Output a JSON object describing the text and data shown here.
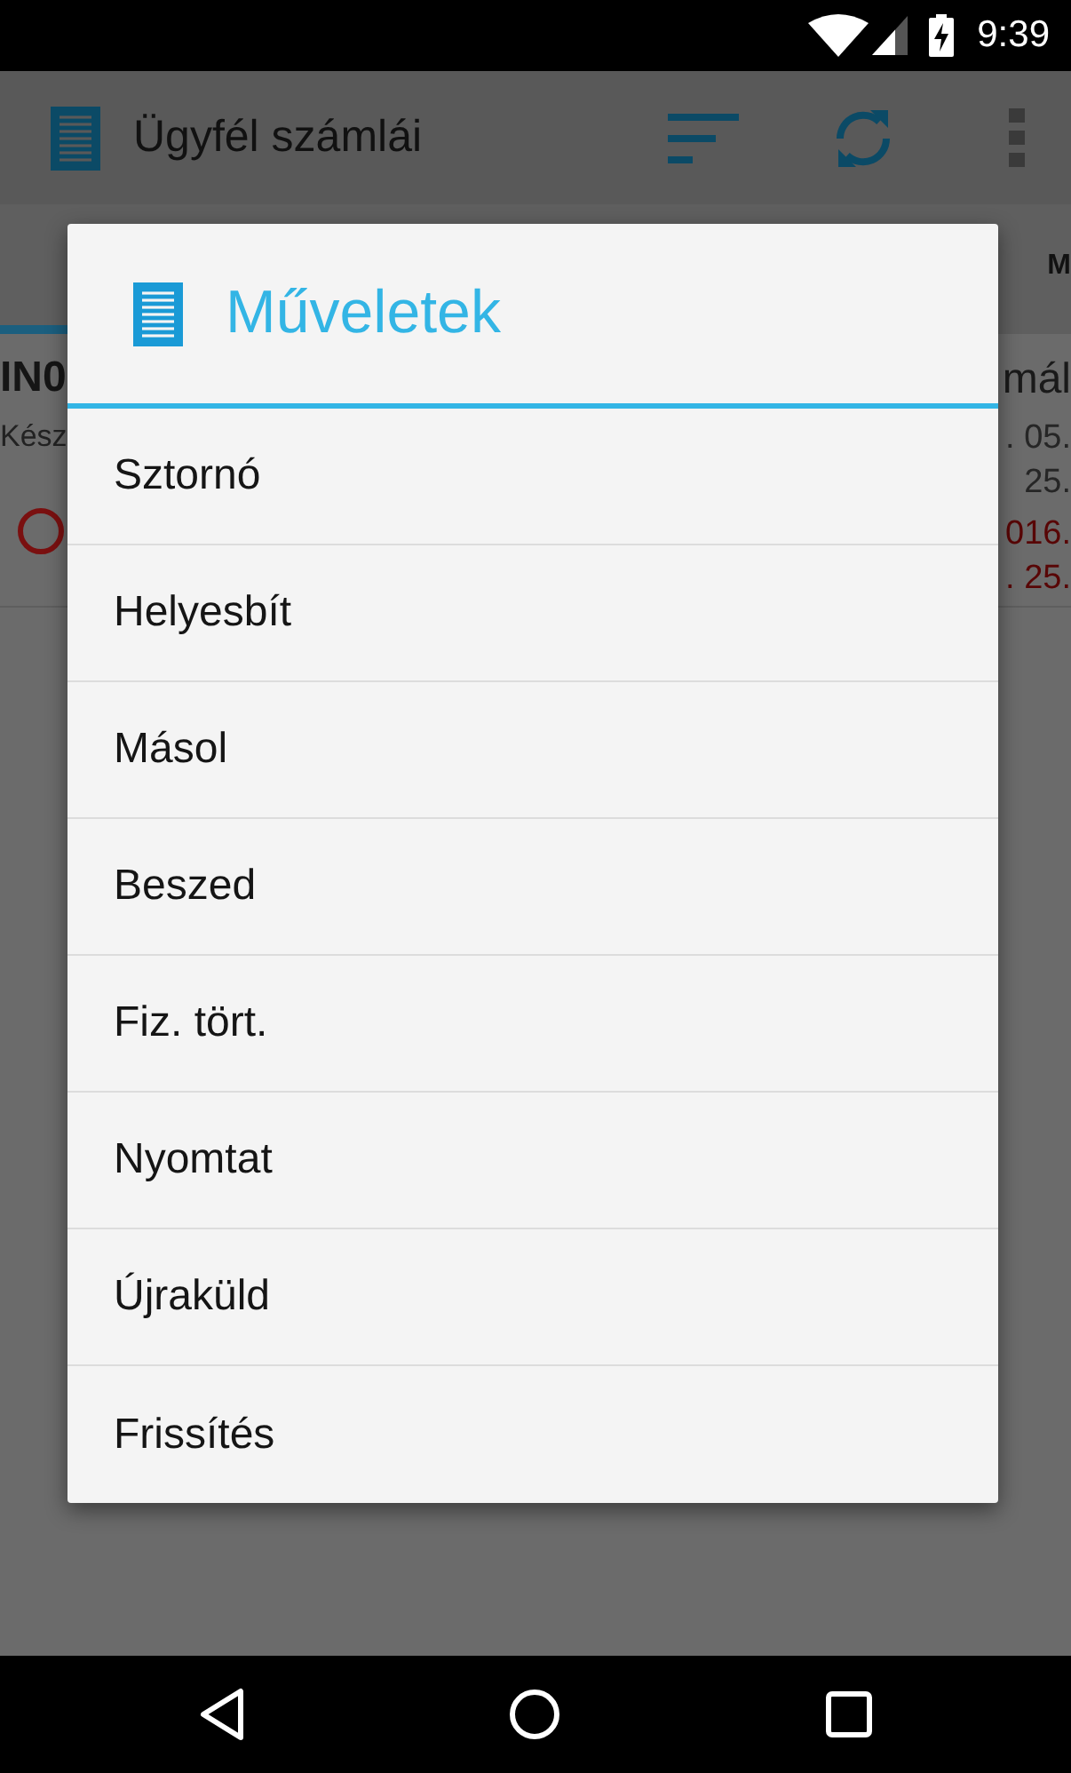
{
  "status_bar": {
    "time": "9:39"
  },
  "app_bar": {
    "title": "Ügyfél számlái"
  },
  "tabs": [
    {
      "selected": true
    },
    {
      "label": "M",
      "selected": false
    }
  ],
  "list_row": {
    "left_lines": [
      "IN0",
      "Kész"
    ],
    "right_lines": [
      {
        "text": "mál",
        "color": "#1a1a1a"
      },
      {
        "text": ". 05.",
        "color": "#262626"
      },
      {
        "text": "25.",
        "color": "#262626"
      },
      {
        "text": "016.",
        "color": "#580606"
      },
      {
        "text": ". 25.",
        "color": "#580606"
      }
    ]
  },
  "dialog": {
    "title": "Műveletek",
    "items": [
      "Sztornó",
      "Helyesbít",
      "Másol",
      "Beszed",
      "Fiz. tört.",
      "Nyomtat",
      "Újraküld",
      "Frissítés"
    ]
  }
}
